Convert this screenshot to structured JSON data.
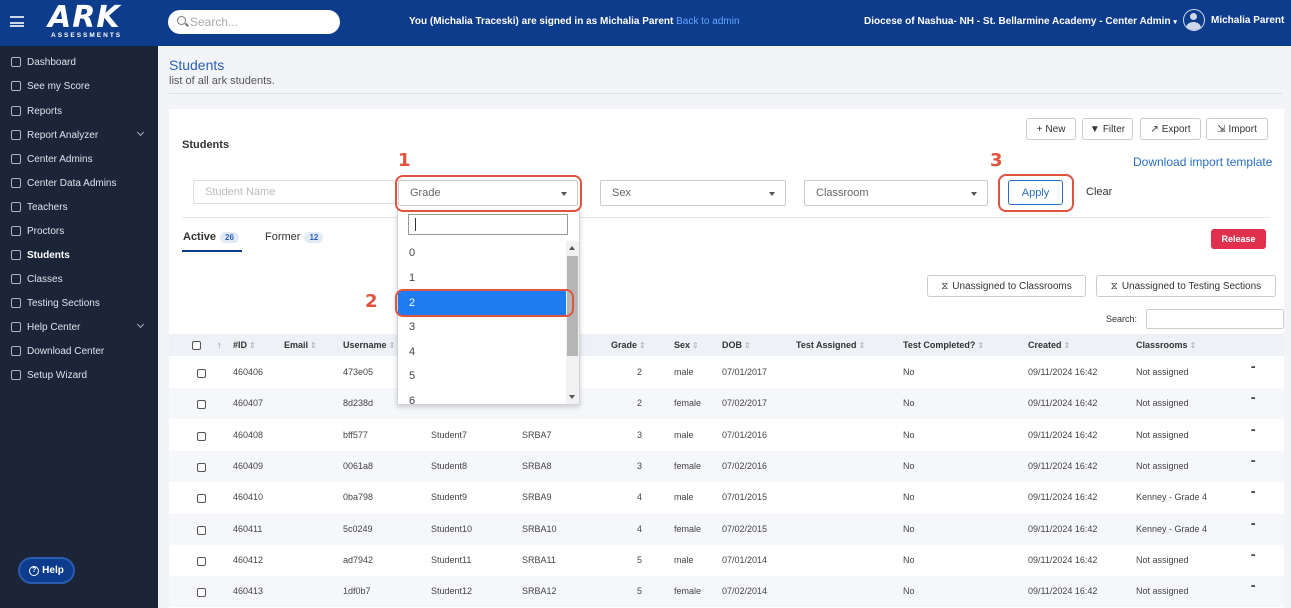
{
  "header": {
    "logo_text": "ARK",
    "logo_subtext": "ASSESSMENTS",
    "search_placeholder": "Search...",
    "signed_in_text": "You (Michalia Traceski) are signed in as Michalia Parent",
    "back_to_admin": "Back to admin",
    "organization": "Diocese of Nashua- NH - St. Bellarmine Academy - Center Admin",
    "user_name": "Michalia Parent"
  },
  "sidebar": {
    "items": [
      {
        "label": "Dashboard",
        "icon": "cloud-icon"
      },
      {
        "label": "See my Score",
        "icon": "user-icon"
      },
      {
        "label": "Reports",
        "icon": "report-icon"
      },
      {
        "label": "Report Analyzer",
        "icon": "globe-icon"
      },
      {
        "label": "Center Admins",
        "icon": "user-icon"
      },
      {
        "label": "Center Data Admins",
        "icon": "users-icon"
      },
      {
        "label": "Teachers",
        "icon": "teacher-icon"
      },
      {
        "label": "Proctors",
        "icon": "proctor-icon"
      },
      {
        "label": "Students",
        "icon": "student-icon"
      },
      {
        "label": "Classes",
        "icon": "class-icon"
      },
      {
        "label": "Testing Sections",
        "icon": "section-icon"
      },
      {
        "label": "Help Center",
        "icon": "globe-icon"
      },
      {
        "label": "Download Center",
        "icon": "download-icon"
      },
      {
        "label": "Setup Wizard",
        "icon": "gear-icon"
      }
    ],
    "active_item": "Students",
    "help_label": "Help"
  },
  "page": {
    "title": "Students",
    "subtitle": "list of all ark students."
  },
  "card": {
    "title": "Students",
    "toolbar": {
      "new_label": "New",
      "filter_label": "Filter",
      "export_label": "Export",
      "import_label": "Import"
    },
    "download_template": "Download import template",
    "filters": {
      "student_name_placeholder": "Student Name",
      "grade": "Grade",
      "sex": "Sex",
      "classroom": "Classroom",
      "apply_label": "Apply",
      "clear_label": "Clear"
    },
    "tabs": [
      {
        "label": "Active",
        "count": "26"
      },
      {
        "label": "Former",
        "count": "12"
      }
    ],
    "release_label": "Release",
    "unassigned_classrooms": "Unassigned to Classrooms",
    "unassigned_testing": "Unassigned to Testing Sections",
    "search_label": "Search:"
  },
  "grade_dropdown": {
    "options": [
      "0",
      "1",
      "2",
      "3",
      "4",
      "5",
      "6"
    ],
    "selected": "2"
  },
  "annotations": [
    "1",
    "2",
    "3"
  ],
  "table": {
    "columns": [
      "#ID",
      "Email",
      "Username",
      "Grade",
      "Sex",
      "DOB",
      "Test Assigned",
      "Test Completed?",
      "Created",
      "Classrooms"
    ],
    "rows": [
      {
        "id": "460406",
        "username": "473e05",
        "first": "",
        "last": "",
        "grade": "2",
        "sex": "male",
        "dob": "07/01/2017",
        "completed": "No",
        "created": "09/11/2024 16:42",
        "classroom": "Not assigned"
      },
      {
        "id": "460407",
        "username": "8d238d",
        "first": "",
        "last": "",
        "grade": "2",
        "sex": "female",
        "dob": "07/02/2017",
        "completed": "No",
        "created": "09/11/2024 16:42",
        "classroom": "Not assigned"
      },
      {
        "id": "460408",
        "username": "bff577",
        "first": "Student7",
        "last": "SRBA7",
        "grade": "3",
        "sex": "male",
        "dob": "07/01/2016",
        "completed": "No",
        "created": "09/11/2024 16:42",
        "classroom": "Not assigned"
      },
      {
        "id": "460409",
        "username": "0061a8",
        "first": "Student8",
        "last": "SRBA8",
        "grade": "3",
        "sex": "female",
        "dob": "07/02/2016",
        "completed": "No",
        "created": "09/11/2024 16:42",
        "classroom": "Not assigned"
      },
      {
        "id": "460410",
        "username": "0ba798",
        "first": "Student9",
        "last": "SRBA9",
        "grade": "4",
        "sex": "male",
        "dob": "07/01/2015",
        "completed": "No",
        "created": "09/11/2024 16:42",
        "classroom": "Kenney - Grade 4"
      },
      {
        "id": "460411",
        "username": "5c0249",
        "first": "Student10",
        "last": "SRBA10",
        "grade": "4",
        "sex": "female",
        "dob": "07/02/2015",
        "completed": "No",
        "created": "09/11/2024 16:42",
        "classroom": "Kenney - Grade 4"
      },
      {
        "id": "460412",
        "username": "ad7942",
        "first": "Student11",
        "last": "SRBA11",
        "grade": "5",
        "sex": "male",
        "dob": "07/01/2014",
        "completed": "No",
        "created": "09/11/2024 16:42",
        "classroom": "Not assigned"
      },
      {
        "id": "460413",
        "username": "1df0b7",
        "first": "Student12",
        "last": "SRBA12",
        "grade": "5",
        "sex": "female",
        "dob": "07/02/2014",
        "completed": "No",
        "created": "09/11/2024 16:42",
        "classroom": "Not assigned"
      }
    ]
  },
  "colors": {
    "topbar": "#0d3c8c",
    "sidebar": "#1c2537",
    "annotation": "#e0533f",
    "selected_option": "#1e7cf0",
    "release": "#e0304e"
  }
}
